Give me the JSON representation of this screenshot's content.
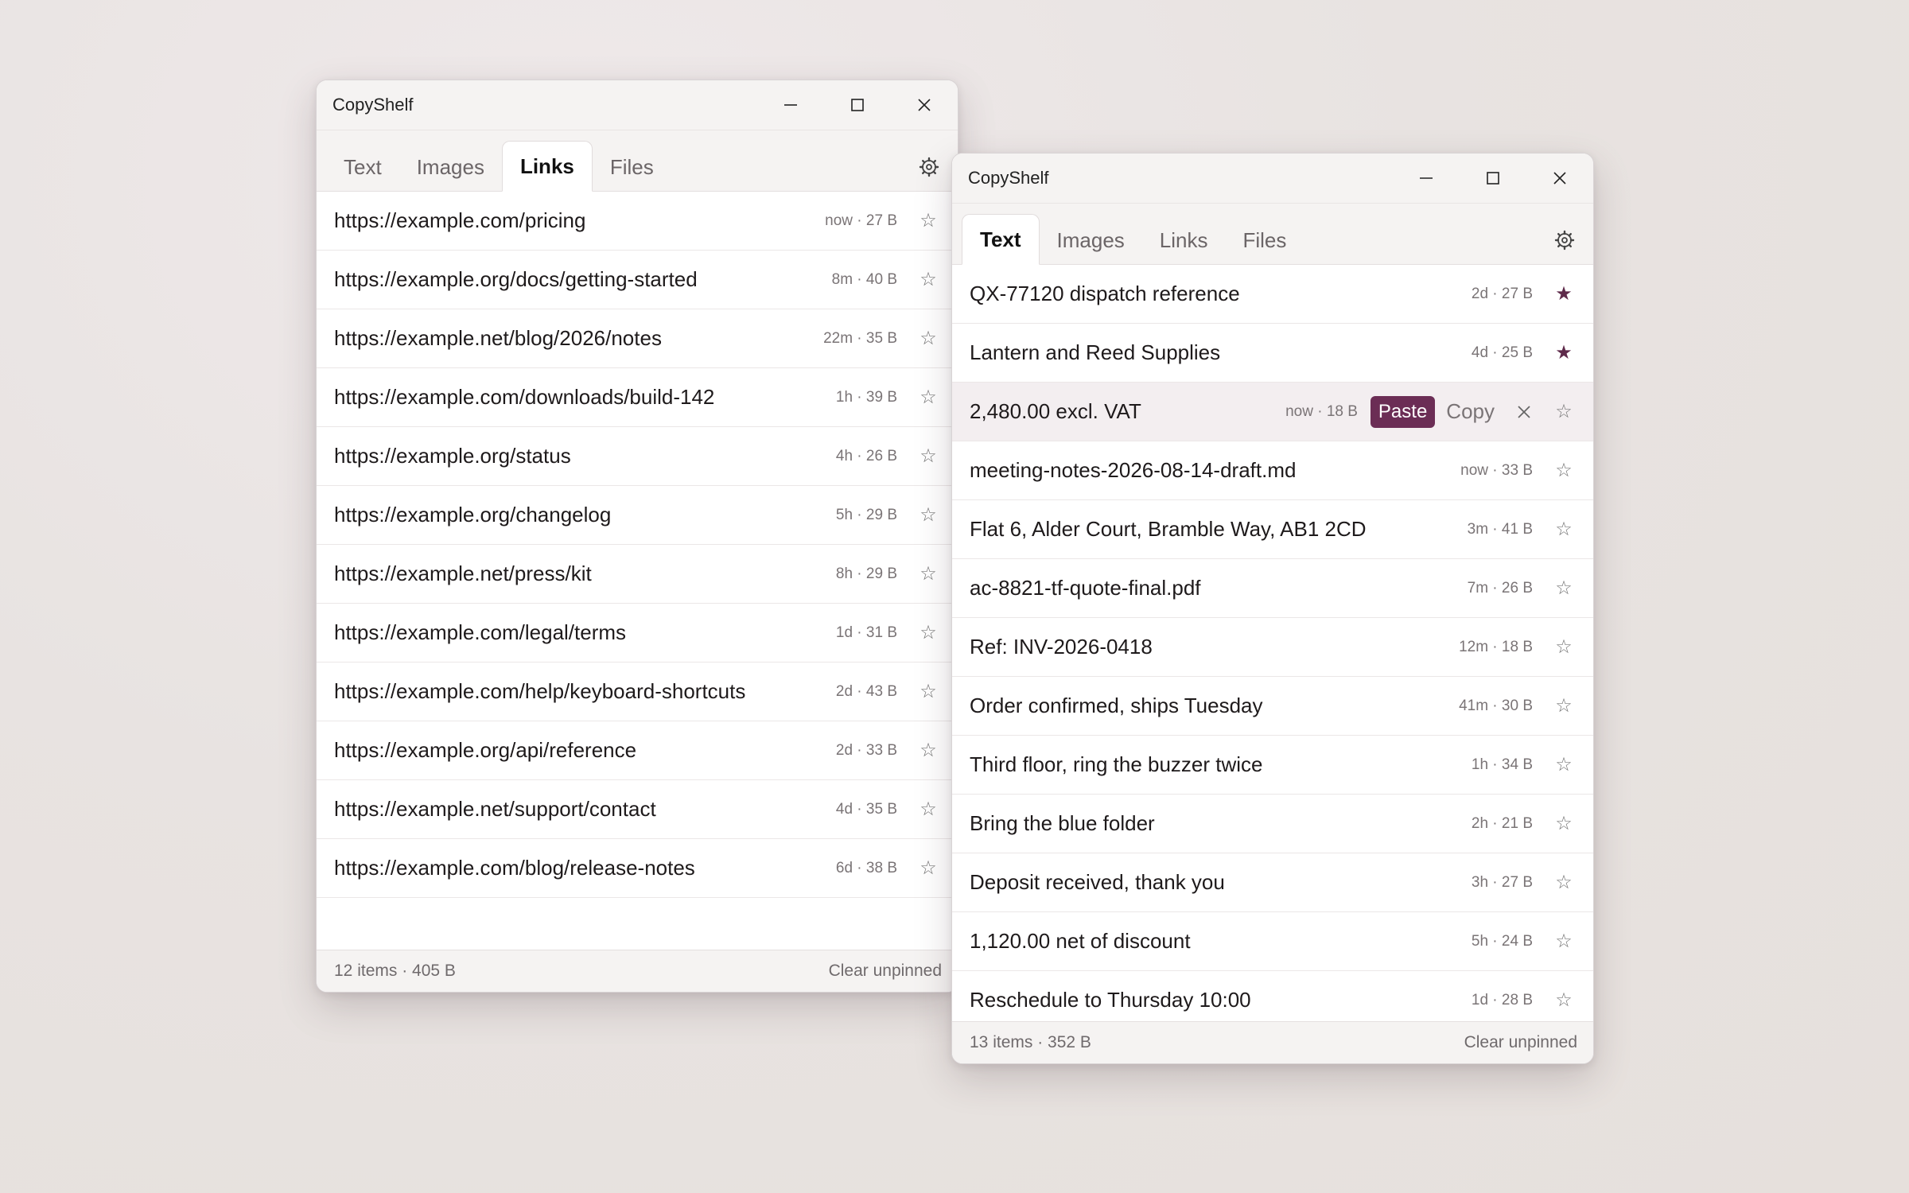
{
  "colors": {
    "accent": "#6b2d55",
    "pinned_star": "#5e2a4a",
    "hover_row": "#f3eef0"
  },
  "icons": {
    "minimize": "minimize-icon",
    "maximize": "maximize-icon",
    "close": "close-icon",
    "settings": "gear-icon",
    "star": "star-icon",
    "remove": "close-icon"
  },
  "links_window": {
    "title": "CopyShelf",
    "tabs": [
      "Text",
      "Images",
      "Links",
      "Files"
    ],
    "active_tab": "Links",
    "items": [
      {
        "text": "https://example.com/pricing",
        "meta": "now · 27 B",
        "star": "☆"
      },
      {
        "text": "https://example.org/docs/getting-started",
        "meta": "8m · 40 B",
        "star": "☆"
      },
      {
        "text": "https://example.net/blog/2026/notes",
        "meta": "22m · 35 B",
        "star": "☆"
      },
      {
        "text": "https://example.com/downloads/build-142",
        "meta": "1h · 39 B",
        "star": "☆"
      },
      {
        "text": "https://example.org/status",
        "meta": "4h · 26 B",
        "star": "☆"
      },
      {
        "text": "https://example.org/changelog",
        "meta": "5h · 29 B",
        "star": "☆"
      },
      {
        "text": "https://example.net/press/kit",
        "meta": "8h · 29 B",
        "star": "☆"
      },
      {
        "text": "https://example.com/legal/terms",
        "meta": "1d · 31 B",
        "star": "☆"
      },
      {
        "text": "https://example.com/help/keyboard-shortcuts",
        "meta": "2d · 43 B",
        "star": "☆"
      },
      {
        "text": "https://example.org/api/reference",
        "meta": "2d · 33 B",
        "star": "☆"
      },
      {
        "text": "https://example.net/support/contact",
        "meta": "4d · 35 B",
        "star": "☆"
      },
      {
        "text": "https://example.com/blog/release-notes",
        "meta": "6d · 38 B",
        "star": "☆"
      }
    ],
    "footer": {
      "summary": "12 items · 405 B",
      "clear": "Clear unpinned"
    }
  },
  "text_window": {
    "title": "CopyShelf",
    "tabs": [
      "Text",
      "Images",
      "Links",
      "Files"
    ],
    "active_tab": "Text",
    "items": [
      {
        "text": "QX-77120 dispatch reference",
        "meta": "2d · 27 B",
        "star": "★",
        "pinned": true
      },
      {
        "text": "Lantern and Reed Supplies",
        "meta": "4d · 25 B",
        "star": "★",
        "pinned": true
      },
      {
        "text": "2,480.00 excl. VAT",
        "meta": "now · 18 B",
        "star": "☆",
        "hover": true,
        "paste": "Paste",
        "copy": "Copy"
      },
      {
        "text": "meeting-notes-2026-08-14-draft.md",
        "meta": "now · 33 B",
        "star": "☆"
      },
      {
        "text": "Flat 6, Alder Court, Bramble Way, AB1 2CD",
        "meta": "3m · 41 B",
        "star": "☆"
      },
      {
        "text": "ac-8821-tf-quote-final.pdf",
        "meta": "7m · 26 B",
        "star": "☆"
      },
      {
        "text": "Ref: INV-2026-0418",
        "meta": "12m · 18 B",
        "star": "☆"
      },
      {
        "text": "Order confirmed, ships Tuesday",
        "meta": "41m · 30 B",
        "star": "☆"
      },
      {
        "text": "Third floor, ring the buzzer twice",
        "meta": "1h · 34 B",
        "star": "☆"
      },
      {
        "text": "Bring the blue folder",
        "meta": "2h · 21 B",
        "star": "☆"
      },
      {
        "text": "Deposit received, thank you",
        "meta": "3h · 27 B",
        "star": "☆"
      },
      {
        "text": "1,120.00 net of discount",
        "meta": "5h · 24 B",
        "star": "☆"
      },
      {
        "text": "Reschedule to Thursday 10:00",
        "meta": "1d · 28 B",
        "star": "☆"
      }
    ],
    "footer": {
      "summary": "13 items · 352 B",
      "clear": "Clear unpinned"
    }
  }
}
